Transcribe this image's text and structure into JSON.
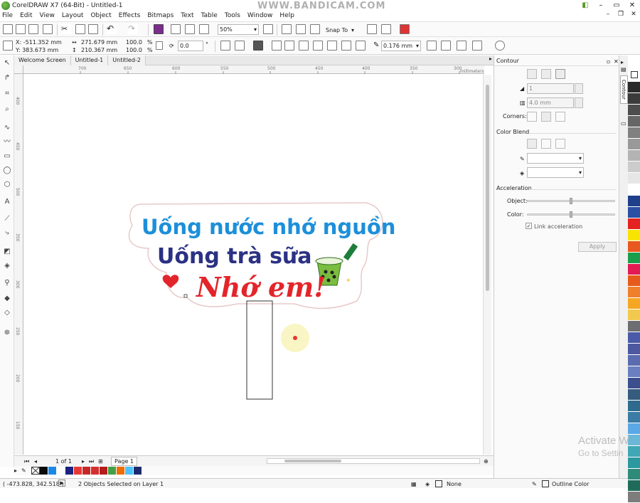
{
  "window": {
    "title": "CorelDRAW X7 (64-Bit) - Untitled-1",
    "watermark": "WWW.BANDICAM.COM"
  },
  "menu": [
    "File",
    "Edit",
    "View",
    "Layout",
    "Object",
    "Effects",
    "Bitmaps",
    "Text",
    "Table",
    "Tools",
    "Window",
    "Help"
  ],
  "toolbar": {
    "zoom": "50%",
    "snap_to": "Snap To"
  },
  "property_bar": {
    "x": "X: -511.352 mm",
    "y": "Y: 383.673 mm",
    "width": "271.679 mm",
    "height": "210.367 mm",
    "scale_w": "100.0",
    "scale_h": "100.0",
    "pct1": "%",
    "pct2": "%",
    "rotation": "0.0",
    "degree": "°",
    "outline": "0.176 mm"
  },
  "tabs": [
    "Welcome Screen",
    "Untitled-1",
    "Untitled-2"
  ],
  "ruler": {
    "h_ticks": [
      "700",
      "650",
      "600",
      "550",
      "500",
      "450",
      "400",
      "350",
      "300"
    ],
    "h_unit": "millimeters",
    "v_ticks": [
      "400",
      "450",
      "500",
      "350",
      "300",
      "250",
      "200",
      "150"
    ]
  },
  "artwork": {
    "line1": "Uống nước nhớ nguồn",
    "line2": "Uống trà sữa",
    "line3": "Nhớ em!"
  },
  "page_nav": {
    "count": "1 of 1",
    "page_tab": "Page 1"
  },
  "status": {
    "coords": "( -473.828, 342.518 )",
    "message": "2 Objects Selected on Layer 1",
    "fill": "None",
    "outline": "Outline Color"
  },
  "docker": {
    "title": "Contour",
    "steps": "1",
    "offset": "4.0 mm",
    "corners_label": "Corners:",
    "color_blend": "Color Blend",
    "acceleration": "Acceleration",
    "object_label": "Object:",
    "color_label": "Color:",
    "link_accel": "Link acceleration",
    "apply": "Apply",
    "side_tab": "Contour"
  },
  "colors": {
    "palette_right": [
      "#2a2a2a",
      "#3b3b3b",
      "#4d4d4d",
      "#666",
      "#808080",
      "#999",
      "#b3b3b3",
      "#ccc",
      "#e6e6e6",
      "#fff",
      "#1e3f8a",
      "#2b4fa3",
      "#e42320",
      "#f9e300",
      "#e8581f",
      "#1a9e4b",
      "#e21b55",
      "#e85a1b",
      "#f07f2b",
      "#f5a623",
      "#f2c94c",
      "#6d6e71",
      "#4a5aa8",
      "#4c58a0",
      "#5b6bb0",
      "#6a7fc0",
      "#3b4f8f",
      "#355c7d",
      "#2f6b8f",
      "#3a7ca5",
      "#5aa9e6",
      "#6bb7d8",
      "#3fa7b5",
      "#2b9aa0",
      "#2f8a7a",
      "#1f6b5a",
      "#7d7d7d"
    ],
    "palette_bottom": [
      "#0a0a0a",
      "#1e88e5",
      "#ffffff",
      "#1a237e",
      "#e53935",
      "#c62828",
      "#d32f2f",
      "#b71c1c",
      "#43a047",
      "#ef6c00",
      "#4fc3f7",
      "#1e2a6e"
    ],
    "text_blue": "#1d8fd9",
    "text_navy": "#2b3183",
    "text_red": "#e3252b"
  }
}
